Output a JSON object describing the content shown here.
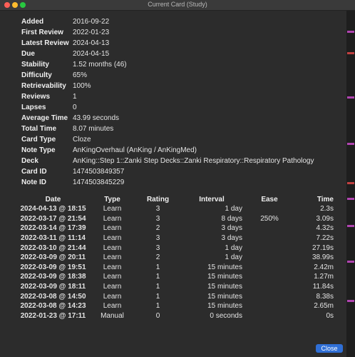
{
  "window": {
    "title": "Current Card (Study)"
  },
  "info": [
    {
      "label": "Added",
      "value": "2016-09-22"
    },
    {
      "label": "First Review",
      "value": "2022-01-23"
    },
    {
      "label": "Latest Review",
      "value": "2024-04-13"
    },
    {
      "label": "Due",
      "value": "2024-04-15"
    },
    {
      "label": "Stability",
      "value": "1.52 months (46)"
    },
    {
      "label": "Difficulty",
      "value": "65%"
    },
    {
      "label": "Retrievability",
      "value": "100%"
    },
    {
      "label": "Reviews",
      "value": "1"
    },
    {
      "label": "Lapses",
      "value": "0"
    },
    {
      "label": "Average Time",
      "value": "43.99 seconds"
    },
    {
      "label": "Total Time",
      "value": "8.07 minutes"
    },
    {
      "label": "Card Type",
      "value": "Cloze"
    },
    {
      "label": "Note Type",
      "value": "AnKingOverhaul (AnKing / AnKingMed)"
    },
    {
      "label": "Deck",
      "value": "AnKing::Step 1::Zanki Step Decks::Zanki Respiratory::Respiratory Pathology"
    },
    {
      "label": "Card ID",
      "value": "1474503849357"
    },
    {
      "label": "Note ID",
      "value": "1474503845229"
    }
  ],
  "revlog": {
    "headers": {
      "date": "Date",
      "type": "Type",
      "rating": "Rating",
      "interval": "Interval",
      "ease": "Ease",
      "time": "Time"
    },
    "rows": [
      {
        "date": "2024-04-13 @ 18:15",
        "type": "Learn",
        "rating": "3",
        "interval": "1 day",
        "ease": "",
        "time": "2.3s",
        "again": false
      },
      {
        "date": "2022-03-17 @ 21:54",
        "type": "Learn",
        "rating": "3",
        "interval": "8 days",
        "ease": "250%",
        "time": "3.09s",
        "again": false
      },
      {
        "date": "2022-03-14 @ 17:39",
        "type": "Learn",
        "rating": "2",
        "interval": "3 days",
        "ease": "",
        "time": "4.32s",
        "again": false
      },
      {
        "date": "2022-03-11 @ 11:14",
        "type": "Learn",
        "rating": "3",
        "interval": "3 days",
        "ease": "",
        "time": "7.22s",
        "again": false
      },
      {
        "date": "2022-03-10 @ 21:44",
        "type": "Learn",
        "rating": "3",
        "interval": "1 day",
        "ease": "",
        "time": "27.19s",
        "again": false
      },
      {
        "date": "2022-03-09 @ 20:11",
        "type": "Learn",
        "rating": "2",
        "interval": "1 day",
        "ease": "",
        "time": "38.99s",
        "again": false
      },
      {
        "date": "2022-03-09 @ 19:51",
        "type": "Learn",
        "rating": "1",
        "interval": "15 minutes",
        "ease": "",
        "time": "2.42m",
        "again": true
      },
      {
        "date": "2022-03-09 @ 18:38",
        "type": "Learn",
        "rating": "1",
        "interval": "15 minutes",
        "ease": "",
        "time": "1.27m",
        "again": true
      },
      {
        "date": "2022-03-09 @ 18:11",
        "type": "Learn",
        "rating": "1",
        "interval": "15 minutes",
        "ease": "",
        "time": "11.84s",
        "again": true
      },
      {
        "date": "2022-03-08 @ 14:50",
        "type": "Learn",
        "rating": "1",
        "interval": "15 minutes",
        "ease": "",
        "time": "8.38s",
        "again": true
      },
      {
        "date": "2022-03-08 @ 14:23",
        "type": "Learn",
        "rating": "1",
        "interval": "15 minutes",
        "ease": "",
        "time": "2.65m",
        "again": true
      },
      {
        "date": "2022-01-23 @ 17:11",
        "type": "Manual",
        "rating": "0",
        "interval": "0 seconds",
        "ease": "",
        "time": "0s",
        "again": false
      }
    ]
  },
  "footer": {
    "close_label": "Close"
  },
  "colors": {
    "learn": "#6ea8f0",
    "again": "#e05050",
    "button": "#2f6fd6",
    "background": "#2c2c2c"
  }
}
